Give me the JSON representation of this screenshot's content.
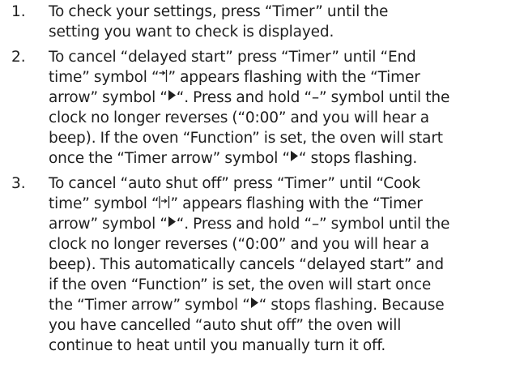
{
  "list": {
    "item1": {
      "number": "1.",
      "l1": "To check your settings, press “Timer” until the",
      "l2": "setting you want to check is displayed."
    },
    "item2": {
      "number": "2.",
      "l1a": "To cancel “delayed start” press “Timer” until “End",
      "l2a": "time” symbol “",
      "l2b": "” appears flashing with the “Timer",
      "l3a": "arrow” symbol “",
      "l3b": "“. Press and hold “–” symbol until the",
      "l4": "clock no longer reverses (“0:00” and you will hear a",
      "l5": "beep). If the oven “Function” is set, the oven will start",
      "l6a": "once the “Timer arrow” symbol “",
      "l6b": "“ stops flashing."
    },
    "item3": {
      "number": "3.",
      "l1": "To cancel “auto shut off” press “Timer” until “Cook",
      "l2a": "time” symbol “",
      "l2b": "” appears flashing with the “Timer",
      "l3a": "arrow” symbol “",
      "l3b": "“. Press and hold “–” symbol until the",
      "l4": "clock no longer reverses (“0:00” and you will hear a",
      "l5": "beep). This automatically cancels “delayed start” and",
      "l6": "if the oven “Function” is set, the oven will start once",
      "l7a": "the “Timer arrow” symbol “",
      "l7b": "“ stops flashing. Because",
      "l8": "you have cancelled “auto shut off” the oven will",
      "l9": "continue to heat until you manually turn it off."
    }
  },
  "icons": {
    "end_time": "end-time-symbol",
    "cook_time": "cook-time-symbol",
    "timer_arrow": "timer-arrow-symbol"
  },
  "colors": {
    "text": "#1f1f1f"
  }
}
